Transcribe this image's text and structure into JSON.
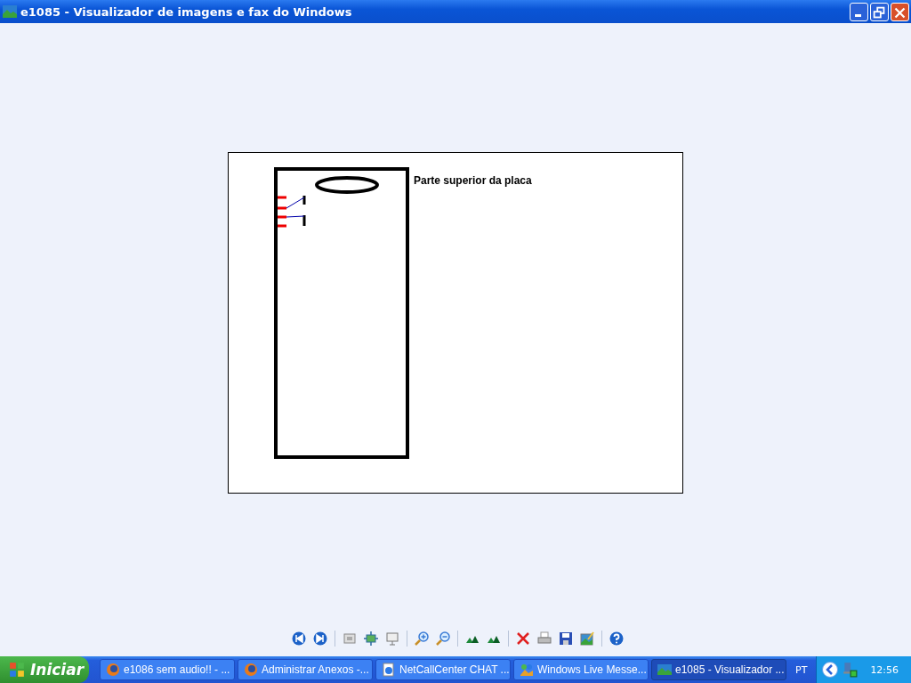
{
  "window": {
    "title": "e1085 - Visualizador de imagens e fax do Windows"
  },
  "image": {
    "caption": "Parte superior da placa"
  },
  "taskbar": {
    "start": "Iniciar",
    "tasks": [
      {
        "label": "e1086 sem audio!! - ...",
        "kind": "browser",
        "selected": false
      },
      {
        "label": "Administrar Anexos -...",
        "kind": "browser",
        "selected": false
      },
      {
        "label": "NetCallCenter CHAT ...",
        "kind": "web",
        "selected": false
      },
      {
        "label": "Windows Live Messe...",
        "kind": "messenger",
        "selected": false
      },
      {
        "label": "e1085 - Visualizador ...",
        "kind": "viewer",
        "selected": true
      }
    ],
    "language": "PT",
    "clock": "12:56"
  }
}
